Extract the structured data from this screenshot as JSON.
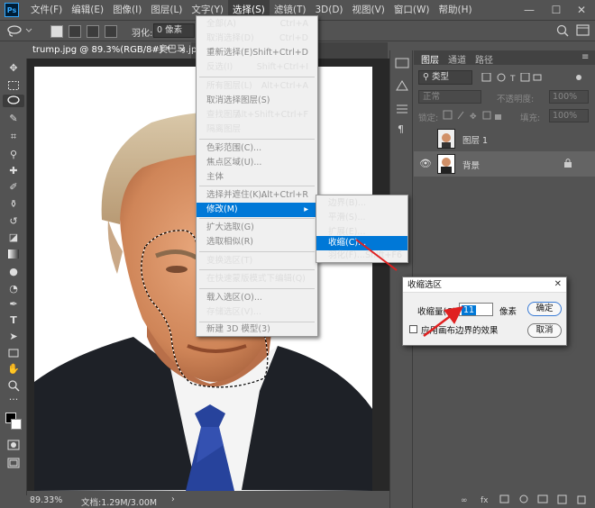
{
  "app": {
    "logo_text": "Ps"
  },
  "menubar": {
    "items": [
      "文件(F)",
      "编辑(E)",
      "图像(I)",
      "图层(L)",
      "文字(Y)",
      "选择(S)",
      "滤镜(T)",
      "3D(D)",
      "视图(V)",
      "窗口(W)",
      "帮助(H)"
    ]
  },
  "window_controls": {
    "minimize": "—",
    "maximize": "☐",
    "close": "✕"
  },
  "options_bar": {
    "feather_label": "羽化:",
    "feather_value": "0 像素"
  },
  "tabs": [
    {
      "label": "trump.jpg @ 89.3%(RGB/8#) *",
      "close": "×"
    },
    {
      "label": "奥巴马.jpg",
      "close": "×"
    }
  ],
  "status": {
    "zoom": "89.33%",
    "doc": "文档:1.29M/3.00M"
  },
  "layers_panel": {
    "tabs": [
      "图层",
      "通道",
      "路径"
    ],
    "kind_label": "类型",
    "blend_mode": "正常",
    "opacity_label": "不透明度:",
    "opacity_value": "100%",
    "lock_label": "锁定:",
    "fill_label": "填充:",
    "fill_value": "100%",
    "layers": [
      {
        "name": "图层 1"
      },
      {
        "name": "背景"
      }
    ]
  },
  "select_menu": {
    "items": [
      {
        "label": "全部(A)",
        "shortcut": "Ctrl+A"
      },
      {
        "label": "取消选择(D)",
        "shortcut": "Ctrl+D"
      },
      {
        "label": "重新选择(E)",
        "shortcut": "Shift+Ctrl+D"
      },
      {
        "label": "反选(I)",
        "shortcut": "Shift+Ctrl+I"
      },
      {
        "label": "所有图层(L)",
        "shortcut": "Alt+Ctrl+A"
      },
      {
        "label": "取消选择图层(S)",
        "shortcut": ""
      },
      {
        "label": "查找图层",
        "shortcut": "Alt+Shift+Ctrl+F"
      },
      {
        "label": "隔离图层",
        "shortcut": ""
      },
      {
        "label": "色彩范围(C)...",
        "shortcut": ""
      },
      {
        "label": "焦点区域(U)...",
        "shortcut": ""
      },
      {
        "label": "主体",
        "shortcut": ""
      },
      {
        "label": "选择并遮住(K)...",
        "shortcut": "Alt+Ctrl+R"
      },
      {
        "label": "修改(M)",
        "shortcut": ""
      },
      {
        "label": "扩大选取(G)",
        "shortcut": ""
      },
      {
        "label": "选取相似(R)",
        "shortcut": ""
      },
      {
        "label": "变换选区(T)",
        "shortcut": ""
      },
      {
        "label": "在快速蒙版模式下编辑(Q)",
        "shortcut": ""
      },
      {
        "label": "载入选区(O)...",
        "shortcut": ""
      },
      {
        "label": "存储选区(V)...",
        "shortcut": ""
      },
      {
        "label": "新建 3D 模型(3)",
        "shortcut": ""
      }
    ]
  },
  "modify_submenu": {
    "items": [
      {
        "label": "边界(B)...",
        "shortcut": ""
      },
      {
        "label": "平滑(S)...",
        "shortcut": ""
      },
      {
        "label": "扩展(E)...",
        "shortcut": ""
      },
      {
        "label": "收缩(C)...",
        "shortcut": ""
      },
      {
        "label": "羽化(F)...",
        "shortcut": "Shift+F6"
      }
    ]
  },
  "contract_dialog": {
    "title": "收缩选区",
    "amount_label": "收缩量(C):",
    "amount_value": "11",
    "unit": "像素",
    "apply_canvas_label": "应用画布边界的效果",
    "ok_label": "确定",
    "cancel_label": "取消"
  },
  "colors": {
    "menu_highlight": "#0078d7",
    "ui_bg": "#535353",
    "arrow": "#e02020"
  }
}
